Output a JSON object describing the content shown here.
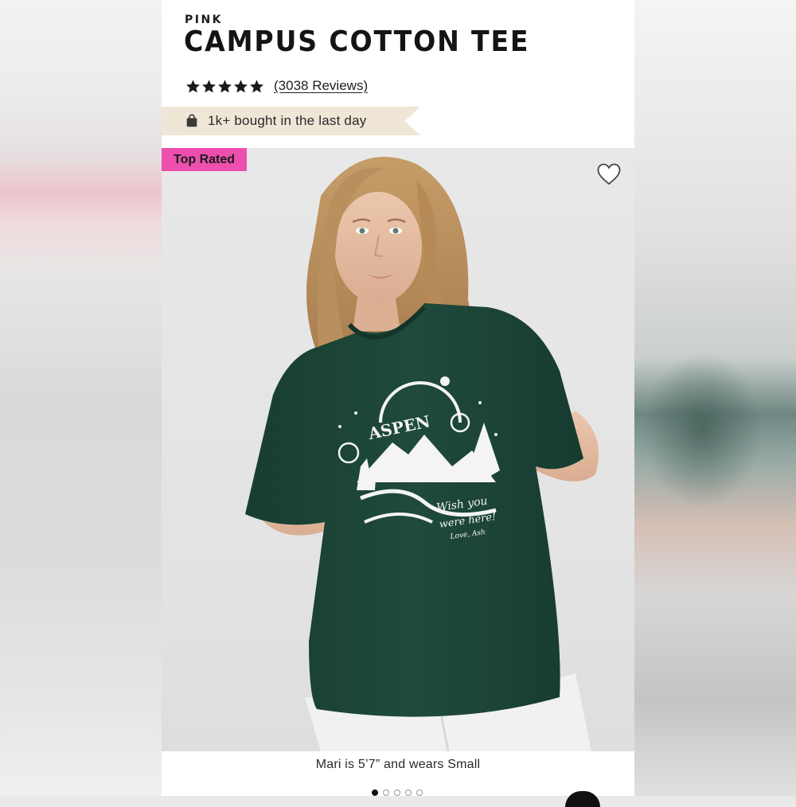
{
  "product": {
    "brand": "PINK",
    "title": "CAMPUS COTTON TEE",
    "rating_stars": 5,
    "reviews_label": "(3038 Reviews)",
    "bought_label": "1k+ bought in the last day"
  },
  "gallery": {
    "badge": "Top Rated",
    "caption": "Mari is 5’7” and wears Small",
    "dots_total": 5,
    "dots_active": 1
  },
  "shirt_print": {
    "headline": "ASPEN",
    "script_line1": "Wish you",
    "script_line2": "were here!",
    "signature": "Love, Ash"
  },
  "icons": {
    "star": "star-icon",
    "bag": "shopping-bag-icon",
    "heart": "heart-outline-icon"
  },
  "colors": {
    "badge_pink": "#ed4fae",
    "bought_bg": "#efe6d7",
    "shirt_green": "#1f4a3c",
    "text": "#141414"
  }
}
